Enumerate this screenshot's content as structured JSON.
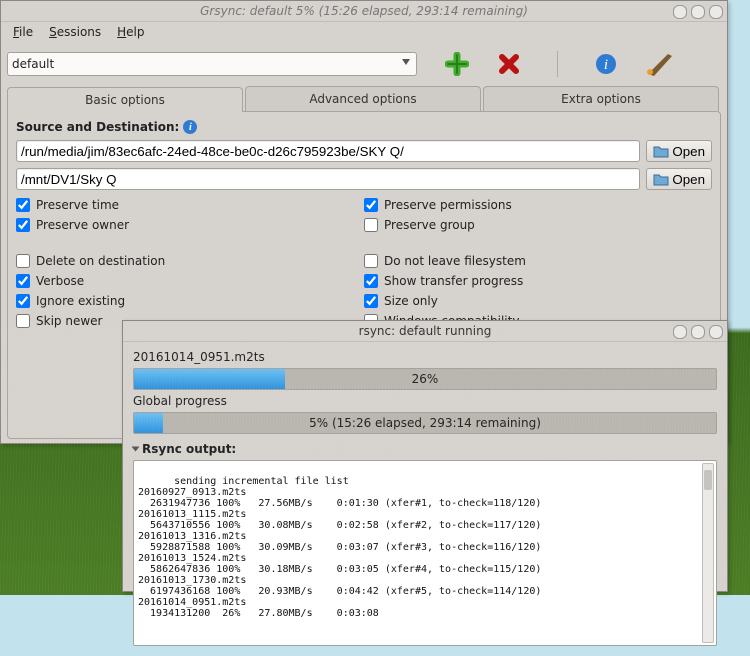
{
  "main_window": {
    "title": "Grsync: default 5% (15:26 elapsed, 293:14 remaining)",
    "menus": {
      "file": "File",
      "sessions": "Sessions",
      "help": "Help"
    },
    "profile_selected": "default",
    "toolbar_icons": [
      "add-icon",
      "remove-icon",
      "info-icon",
      "run-icon"
    ],
    "tabs": {
      "basic": "Basic options",
      "advanced": "Advanced options",
      "extra": "Extra options"
    },
    "source_heading": "Source and Destination:",
    "source_path": "/run/media/jim/83ec6afc-24ed-48ce-be0c-d26c795923be/SKY Q/",
    "dest_path": "/mnt/DV1/Sky Q",
    "open_label": "Open",
    "checks": {
      "preserve_time": {
        "label": "Preserve time",
        "checked": true
      },
      "preserve_owner": {
        "label": "Preserve owner",
        "checked": true
      },
      "delete_dest": {
        "label": "Delete on destination",
        "checked": false
      },
      "verbose": {
        "label": "Verbose",
        "checked": true
      },
      "ignore_existing": {
        "label": "Ignore existing",
        "checked": true
      },
      "skip_newer": {
        "label": "Skip newer",
        "checked": false
      },
      "preserve_perms": {
        "label": "Preserve permissions",
        "checked": true
      },
      "preserve_group": {
        "label": "Preserve group",
        "checked": false
      },
      "no_leave_fs": {
        "label": "Do not leave filesystem",
        "checked": false
      },
      "show_progress": {
        "label": "Show transfer progress",
        "checked": true
      },
      "size_only": {
        "label": "Size only",
        "checked": true
      },
      "win_compat": {
        "label": "Windows compatibility",
        "checked": false
      }
    }
  },
  "progress_window": {
    "title": "rsync: default running",
    "current_file": "20161014_0951.m2ts",
    "file_pct": 26,
    "file_pct_text": "26%",
    "global_label": "Global progress",
    "global_pct": 5,
    "global_text": "5% (15:26 elapsed, 293:14 remaining)",
    "output_heading": "Rsync output:",
    "output_text": "sending incremental file list\n20160927_0913.m2ts\n  2631947736 100%   27.56MB/s    0:01:30 (xfer#1, to-check=118/120)\n20161013_1115.m2ts\n  5643710556 100%   30.08MB/s    0:02:58 (xfer#2, to-check=117/120)\n20161013_1316.m2ts\n  5928871588 100%   30.09MB/s    0:03:07 (xfer#3, to-check=116/120)\n20161013_1524.m2ts\n  5862647836 100%   30.18MB/s    0:03:05 (xfer#4, to-check=115/120)\n20161013_1730.m2ts\n  6197436168 100%   20.93MB/s    0:04:42 (xfer#5, to-check=114/120)\n20161014_0951.m2ts\n  1934131200  26%   27.80MB/s    0:03:08"
  }
}
